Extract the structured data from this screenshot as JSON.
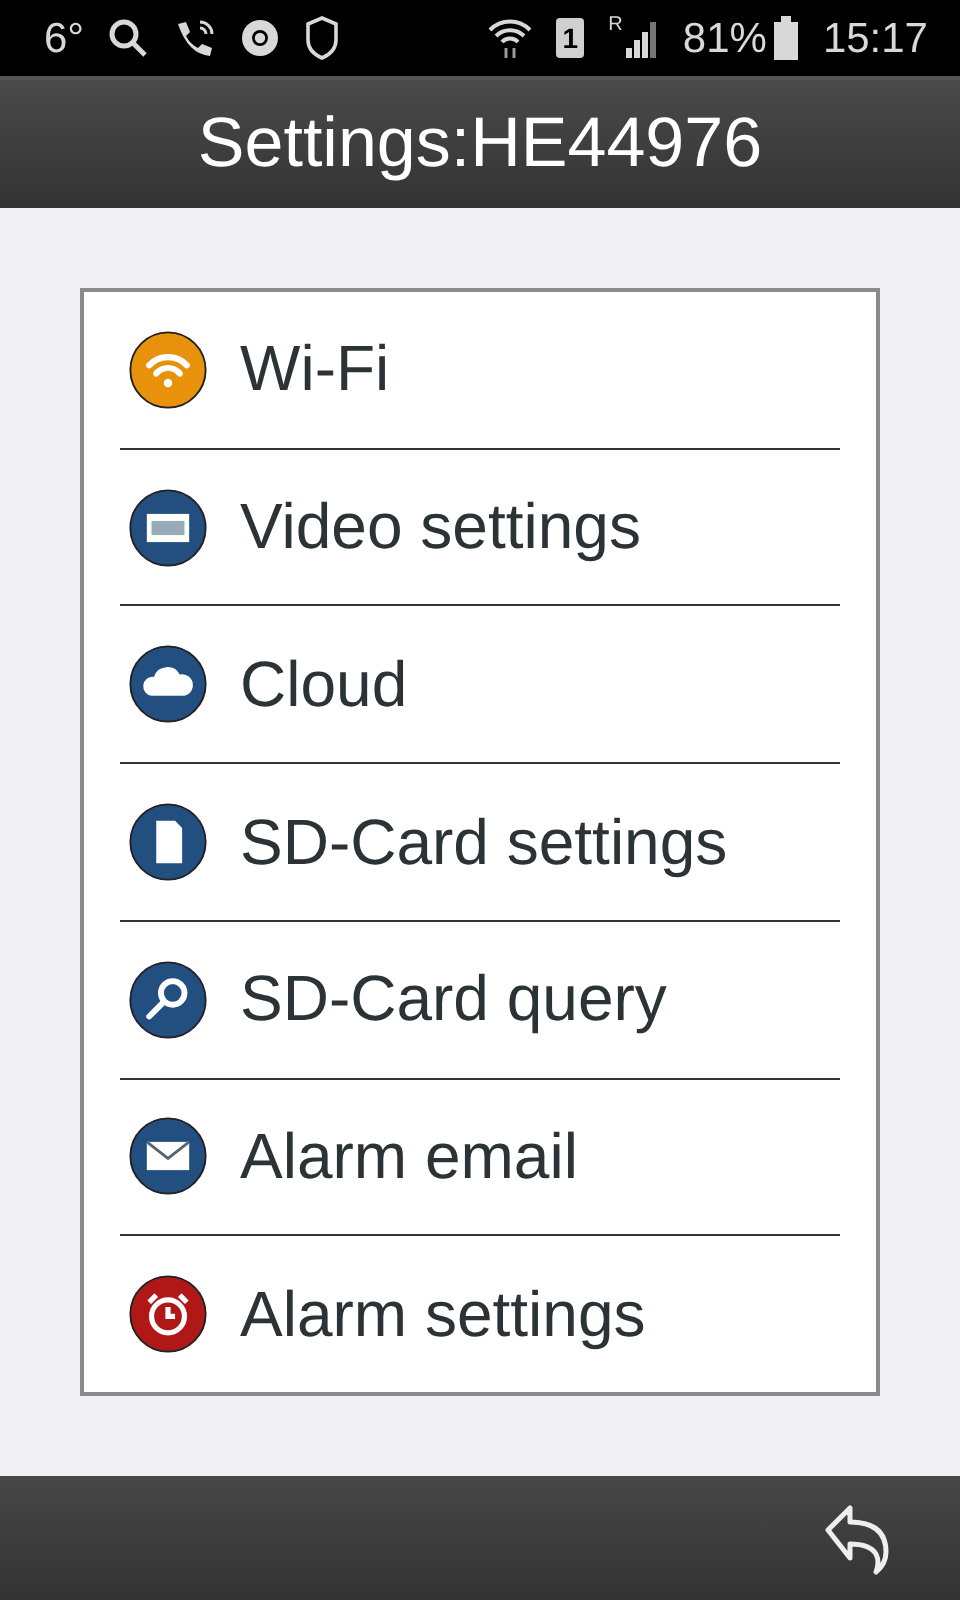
{
  "status_bar": {
    "temperature": "6°",
    "sim_slot": "1",
    "roaming": "R",
    "battery": "81%",
    "time": "15:17"
  },
  "title": "Settings:HE44976",
  "items": [
    {
      "label": "Wi-Fi",
      "kind": "wifi",
      "color": "#e8920c"
    },
    {
      "label": "Video settings",
      "kind": "video",
      "color": "#234f80"
    },
    {
      "label": "Cloud",
      "kind": "cloud",
      "color": "#234f80"
    },
    {
      "label": "SD-Card settings",
      "kind": "sd",
      "color": "#234f80"
    },
    {
      "label": "SD-Card query",
      "kind": "search",
      "color": "#234f80"
    },
    {
      "label": "Alarm email",
      "kind": "mail",
      "color": "#234f80"
    },
    {
      "label": "Alarm settings",
      "kind": "alarm",
      "color": "#b01818"
    }
  ]
}
